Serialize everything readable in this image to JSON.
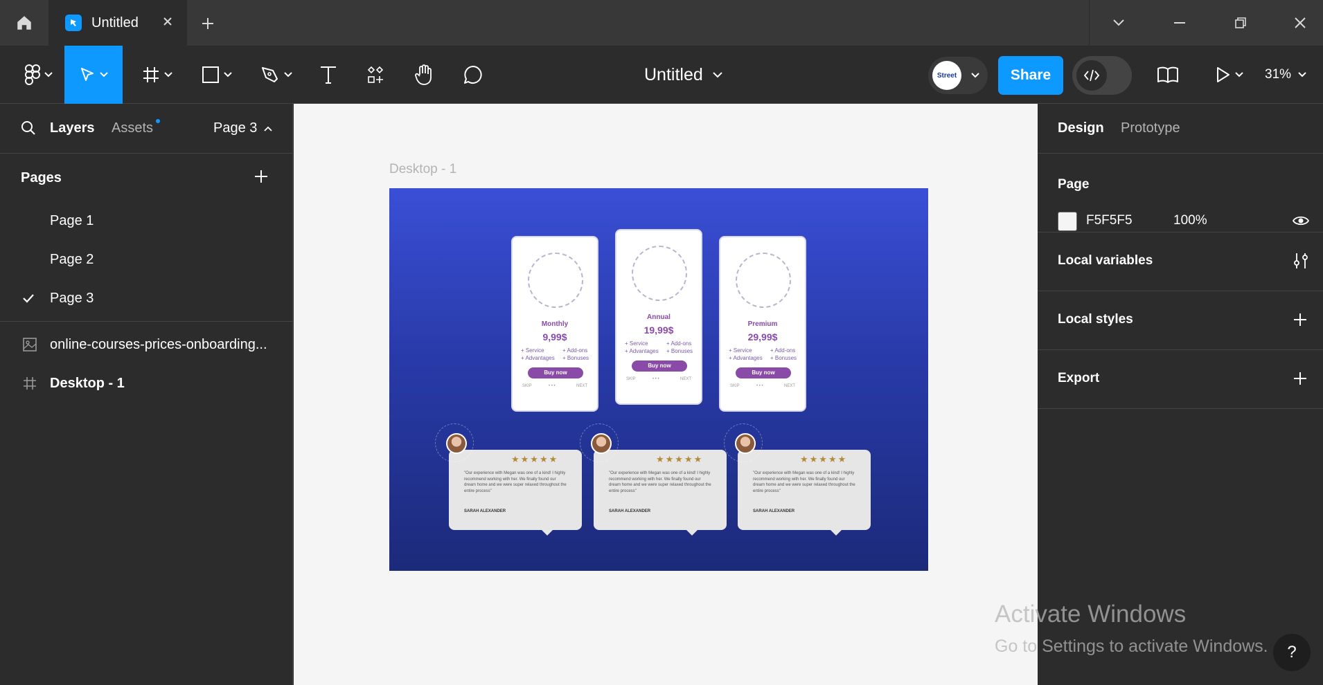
{
  "titlebar": {
    "tab_title": "Untitled"
  },
  "toolbar": {
    "document_title": "Untitled",
    "share_label": "Share",
    "zoom_label": "31%",
    "avatar_text": "Street"
  },
  "left_panel": {
    "tabs": {
      "layers": "Layers",
      "assets": "Assets"
    },
    "current_page": "Page 3",
    "pages_header": "Pages",
    "pages": [
      {
        "label": "Page 1",
        "selected": false
      },
      {
        "label": "Page 2",
        "selected": false
      },
      {
        "label": "Page 3",
        "selected": true
      }
    ],
    "layers": [
      {
        "label": "online-courses-prices-onboarding...",
        "icon": "image-icon"
      },
      {
        "label": "Desktop - 1",
        "icon": "frame-icon"
      }
    ]
  },
  "canvas": {
    "frame_label": "Desktop - 1",
    "background": "#F5F5F5",
    "plans": [
      {
        "name": "Monthly",
        "price": "9,99$",
        "f1": "+ Service",
        "f2": "+ Advantages",
        "f3": "+ Add-ons",
        "f4": "+ Bonuses",
        "cta": "Buy now",
        "skip": "SKIP",
        "next": "NEXT"
      },
      {
        "name": "Annual",
        "price": "19,99$",
        "f1": "+ Service",
        "f2": "+ Advantages",
        "f3": "+ Add-ons",
        "f4": "+ Bonuses",
        "cta": "Buy now",
        "skip": "SKIP",
        "next": "NEXT"
      },
      {
        "name": "Premium",
        "price": "29,99$",
        "f1": "+ Service",
        "f2": "+ Advantages",
        "f3": "+ Add-ons",
        "f4": "+ Bonuses",
        "cta": "Buy now",
        "skip": "SKIP",
        "next": "NEXT"
      }
    ],
    "testimonials": [
      {
        "stars": "★★★★★",
        "quote": "\"Our experience with Megan was one of a kind! I highly recommend working with her. We finally found our dream home and we were super relaxed throughout the entire process\"",
        "author": "SARAH ALEXANDER"
      },
      {
        "stars": "★★★★★",
        "quote": "\"Our experience with Megan was one of a kind! I highly recommend working with her. We finally found our dream home and we were super relaxed throughout the entire process\"",
        "author": "SARAH ALEXANDER"
      },
      {
        "stars": "★★★★★",
        "quote": "\"Our experience with Megan was one of a kind! I highly recommend working with her. We finally found our dream home and we were super relaxed throughout the entire process\"",
        "author": "SARAH ALEXANDER"
      }
    ],
    "watermark_title": "Activate Windows",
    "watermark_sub": "Go to Settings to activate Windows."
  },
  "right_panel": {
    "tabs": {
      "design": "Design",
      "prototype": "Prototype"
    },
    "page_section": "Page",
    "page_color_hex": "F5F5F5",
    "page_opacity": "100%",
    "local_variables": "Local variables",
    "local_styles": "Local styles",
    "export": "Export"
  },
  "help_label": "?",
  "colors": {
    "accent": "#0d99ff",
    "panel": "#2c2c2c",
    "titlebar": "#383838"
  }
}
